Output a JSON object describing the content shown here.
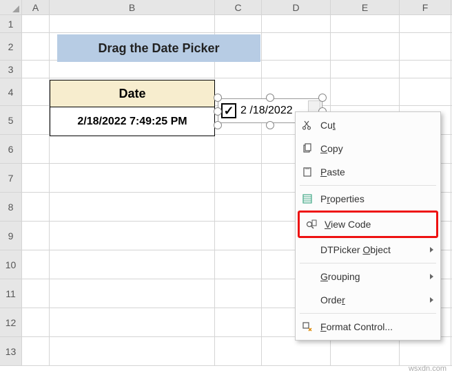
{
  "columns": [
    "A",
    "B",
    "C",
    "D",
    "E",
    "F"
  ],
  "rows": [
    "1",
    "2",
    "3",
    "4",
    "5",
    "6",
    "7",
    "8",
    "9",
    "10",
    "11",
    "12",
    "13"
  ],
  "title": "Drag the Date Picker",
  "table": {
    "header": "Date",
    "value": "2/18/2022  7:49:25 PM"
  },
  "dtpicker": {
    "checked": "✓",
    "date": "2 /18/2022"
  },
  "menu": {
    "cut": "Cut",
    "copy": "Copy",
    "paste": "Paste",
    "properties": "Properties",
    "view_code": "View Code",
    "dtpicker_object": "DTPicker Object",
    "grouping": "Grouping",
    "order": "Order",
    "format_control": "Format Control..."
  },
  "watermark": "wsxdn.com"
}
